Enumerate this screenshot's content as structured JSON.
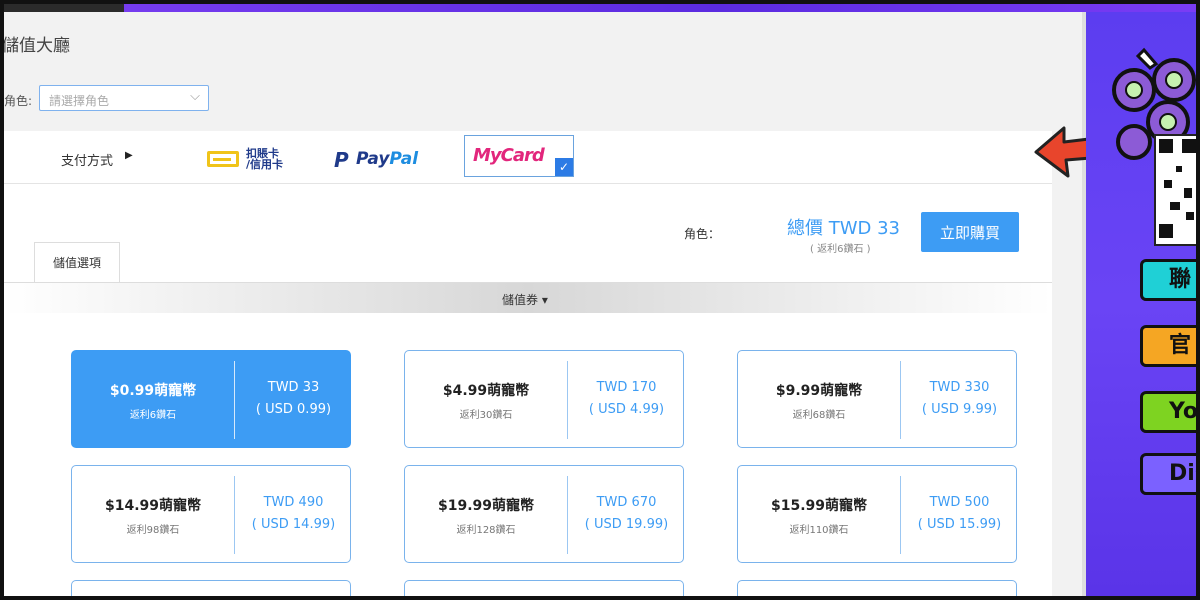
{
  "page": {
    "title": "儲值大廳"
  },
  "role_select": {
    "label": "角色:",
    "placeholder": "請選擇角色"
  },
  "payment": {
    "label": "支付方式",
    "methods": [
      {
        "name": "扣賬卡/信用卡",
        "line1": "扣賬卡",
        "line2": "/信用卡"
      },
      {
        "name": "PayPal",
        "pay": "Pay",
        "pal": "Pal"
      },
      {
        "name": "MyCard",
        "text": "MyCard",
        "selected": true
      }
    ]
  },
  "purchase": {
    "role_label": "角色：",
    "total": "總價 TWD 33",
    "rebate": "( 返利6鑽石 )",
    "buy_label": "立即購買"
  },
  "tabs": [
    {
      "label": "儲值選項",
      "active": true
    }
  ],
  "coupon": {
    "label": "儲值券"
  },
  "options": [
    {
      "name": "$0.99萌寵幣",
      "rebate": "返利6鑽石",
      "twd": "TWD 33",
      "usd": "( USD 0.99)",
      "selected": true
    },
    {
      "name": "$4.99萌寵幣",
      "rebate": "返利30鑽石",
      "twd": "TWD 170",
      "usd": "( USD 4.99)",
      "selected": false
    },
    {
      "name": "$9.99萌寵幣",
      "rebate": "返利68鑽石",
      "twd": "TWD 330",
      "usd": "( USD 9.99)",
      "selected": false
    },
    {
      "name": "$14.99萌寵幣",
      "rebate": "返利98鑽石",
      "twd": "TWD 490",
      "usd": "( USD 14.99)",
      "selected": false
    },
    {
      "name": "$19.99萌寵幣",
      "rebate": "返利128鑽石",
      "twd": "TWD 670",
      "usd": "( USD 19.99)",
      "selected": false
    },
    {
      "name": "$15.99萌寵幣",
      "rebate": "返利110鑽石",
      "twd": "TWD 500",
      "usd": "( USD 15.99)",
      "selected": false
    }
  ],
  "side_buttons": [
    {
      "text": "聯",
      "color": "#1fd0d6"
    },
    {
      "text": "官",
      "color": "#f5a623"
    },
    {
      "text": "Yo",
      "color": "#7ed321"
    },
    {
      "text": "Disc",
      "color": "#7b61ff"
    }
  ],
  "colors": {
    "accent": "#3d9cf4",
    "highlight_arrow": "#e8452c",
    "side_panel": "#6a44f5"
  }
}
